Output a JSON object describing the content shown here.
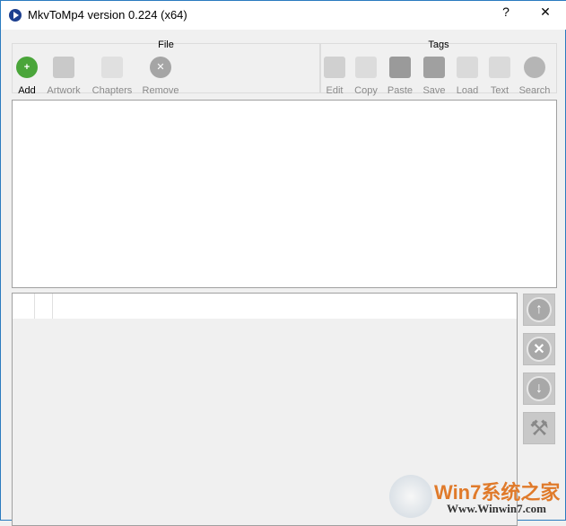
{
  "window": {
    "title": "MkvToMp4 version 0.224 (x64)",
    "help": "?",
    "close": "✕"
  },
  "toolbar": {
    "file_group": "File",
    "file_tools": [
      {
        "label": "Add"
      },
      {
        "label": "Artwork"
      },
      {
        "label": "Chapters"
      },
      {
        "label": "Remove"
      }
    ],
    "tags_group": "Tags",
    "tags_tools": [
      {
        "label": "Edit"
      },
      {
        "label": "Copy"
      },
      {
        "label": "Paste"
      },
      {
        "label": "Save"
      },
      {
        "label": "Load"
      },
      {
        "label": "Text"
      },
      {
        "label": "Search"
      }
    ]
  },
  "side_buttons": {
    "up": "↑",
    "remove": "✕",
    "down": "↓",
    "tools": "⚒"
  },
  "watermark": {
    "brand": "Win7系统之家",
    "url": "Www.Winwin7.com"
  }
}
